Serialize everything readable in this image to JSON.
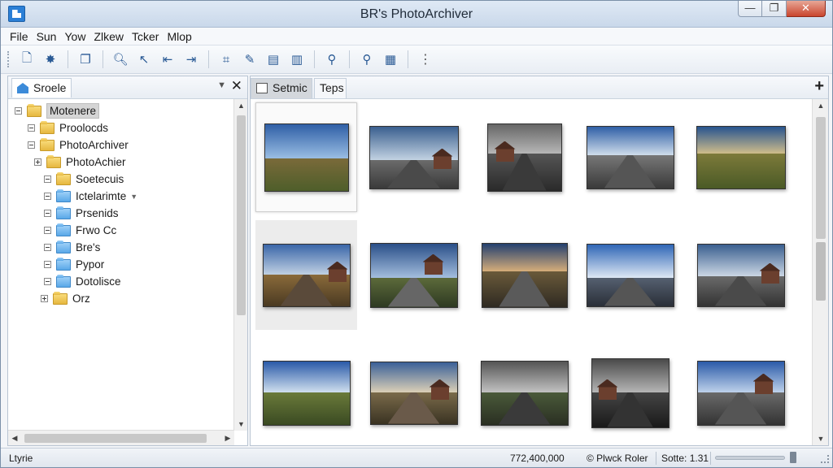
{
  "window": {
    "title": "BR's PhotoArchiver",
    "controls": {
      "minimize": "—",
      "maximize": "❐",
      "close": "✕"
    }
  },
  "menu": [
    "File",
    "Sun",
    "Yow",
    "Zlkew",
    "Tcker",
    "Mlop"
  ],
  "toolbar": {
    "buttons": [
      {
        "icon": "new-file-icon",
        "glyph": "🗋"
      },
      {
        "icon": "gear-sparkle-icon",
        "glyph": "✸"
      },
      {
        "icon": "copy-icon",
        "glyph": "❐"
      },
      {
        "icon": "zoom-search-icon",
        "glyph": "🔍︎"
      },
      {
        "icon": "pointer-icon",
        "glyph": "↖"
      },
      {
        "icon": "import-icon",
        "glyph": "⇤"
      },
      {
        "icon": "export-icon",
        "glyph": "⇥"
      },
      {
        "icon": "select-crop-icon",
        "glyph": "⌗"
      },
      {
        "icon": "pencil-icon",
        "glyph": "✎"
      },
      {
        "icon": "save-icon",
        "glyph": "▤"
      },
      {
        "icon": "chart-icon",
        "glyph": "▥"
      },
      {
        "icon": "search-icon",
        "glyph": "⚲"
      },
      {
        "icon": "find-icon",
        "glyph": "⚲"
      },
      {
        "icon": "grid-view-icon",
        "glyph": "▦"
      }
    ],
    "more_glyph": "⋮"
  },
  "left_pane": {
    "tab_label": "Sroele",
    "pin_glyph": "▼",
    "close_glyph": "✕",
    "tree": [
      {
        "label": "Motenere",
        "depth": 0,
        "expander": "open",
        "color": "yellow",
        "selected": true
      },
      {
        "label": "Proolocds",
        "depth": 1,
        "expander": "open",
        "color": "yellow"
      },
      {
        "label": "PhotoArchiver",
        "depth": 1,
        "expander": "open",
        "color": "yellow"
      },
      {
        "label": "PhotoAchier",
        "depth": 2,
        "expander": "closed",
        "color": "yellow"
      },
      {
        "label": "Soetecuis",
        "depth": 3,
        "expander": "open",
        "color": "yellow"
      },
      {
        "label": "Ictelarimte",
        "depth": 3,
        "expander": "open",
        "color": "blue",
        "dropdown": true
      },
      {
        "label": "Prsenids",
        "depth": 3,
        "expander": "open",
        "color": "blue"
      },
      {
        "label": "Frwo Cc",
        "depth": 3,
        "expander": "open",
        "color": "blue"
      },
      {
        "label": "Bre's",
        "depth": 3,
        "expander": "open",
        "color": "blue"
      },
      {
        "label": "Pypor",
        "depth": 3,
        "expander": "open",
        "color": "blue"
      },
      {
        "label": "Dotolisce",
        "depth": 3,
        "expander": "open",
        "color": "blue"
      },
      {
        "label": "Orz",
        "depth": 2,
        "expander": "closed",
        "color": "yellow"
      }
    ]
  },
  "right_pane": {
    "tabs": [
      {
        "label": "Setmic",
        "active": true
      },
      {
        "label": "Teps",
        "active": false
      }
    ],
    "add_tab_glyph": "+",
    "thumbnails": [
      {
        "scene": "field-road",
        "selected": true
      },
      {
        "scene": "road-town"
      },
      {
        "scene": "street-dark"
      },
      {
        "scene": "road-rail"
      },
      {
        "scene": "field"
      },
      {
        "scene": "rail-house",
        "hovered": true
      },
      {
        "scene": "street-houses"
      },
      {
        "scene": "road-sunset"
      },
      {
        "scene": "road-water"
      },
      {
        "scene": "road-house"
      },
      {
        "scene": "field-path"
      },
      {
        "scene": "path-houses"
      },
      {
        "scene": "road-trees"
      },
      {
        "scene": "rail-night"
      },
      {
        "scene": "street-houses2"
      }
    ]
  },
  "statusbar": {
    "left": "Ltyrie",
    "coords": "772,400,000",
    "camera": "© Plwck Roler",
    "size": "Sotte: 1.31"
  },
  "colors": {
    "titlebar": "#c9d8ea",
    "close_button": "#c9452e",
    "folder_yellow": "#e6b73f",
    "folder_blue": "#5aa8e8",
    "accent": "#2b7fd6"
  }
}
